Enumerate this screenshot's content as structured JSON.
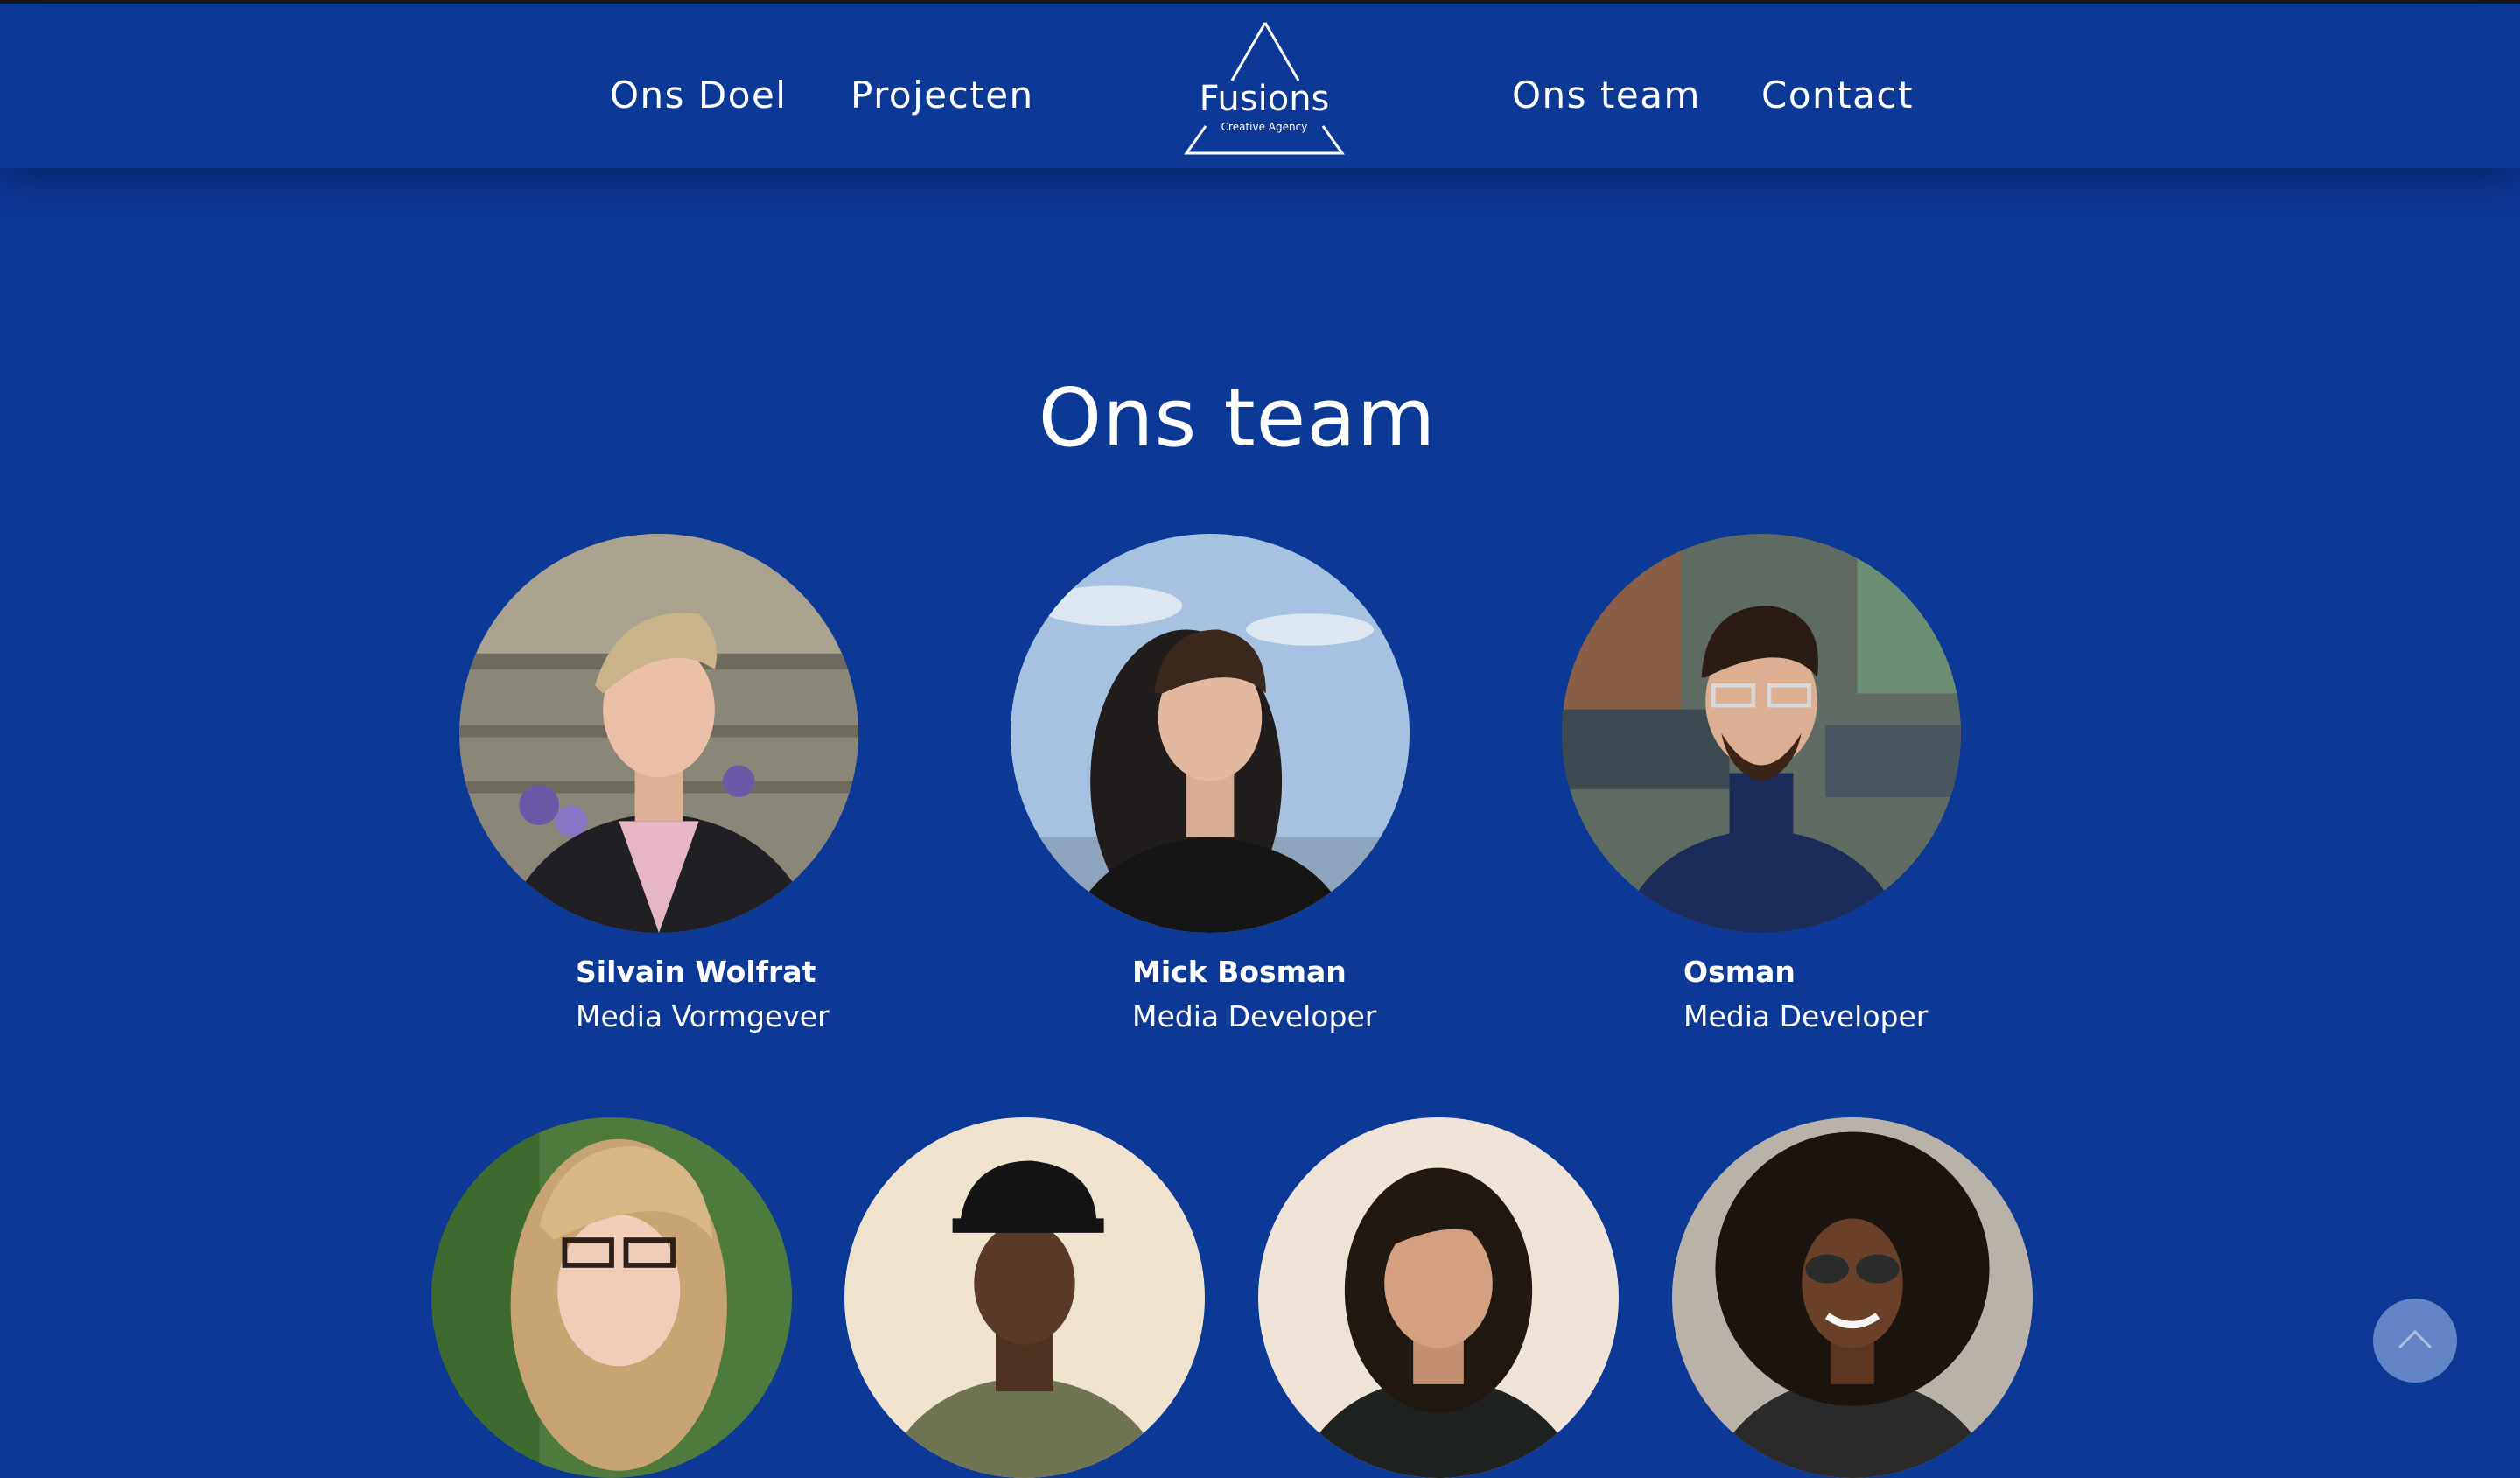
{
  "nav": {
    "left": [
      "Ons Doel",
      "Projecten"
    ],
    "right": [
      "Ons team",
      "Contact"
    ]
  },
  "logo": {
    "name": "Fusions",
    "tagline": "Creative Agency"
  },
  "team_section": {
    "title": "Ons team"
  },
  "members": [
    {
      "name": "Silvain Wolfrat",
      "role": "Media Vormgever"
    },
    {
      "name": "Mick Bosman",
      "role": "Media Developer"
    },
    {
      "name": "Osman",
      "role": "Media Developer"
    }
  ],
  "scroll_top": {
    "icon": "chevron-up-icon"
  },
  "colors": {
    "background": "#0c3896",
    "text": "#ffffff",
    "scroll_button": "#6384c6"
  }
}
